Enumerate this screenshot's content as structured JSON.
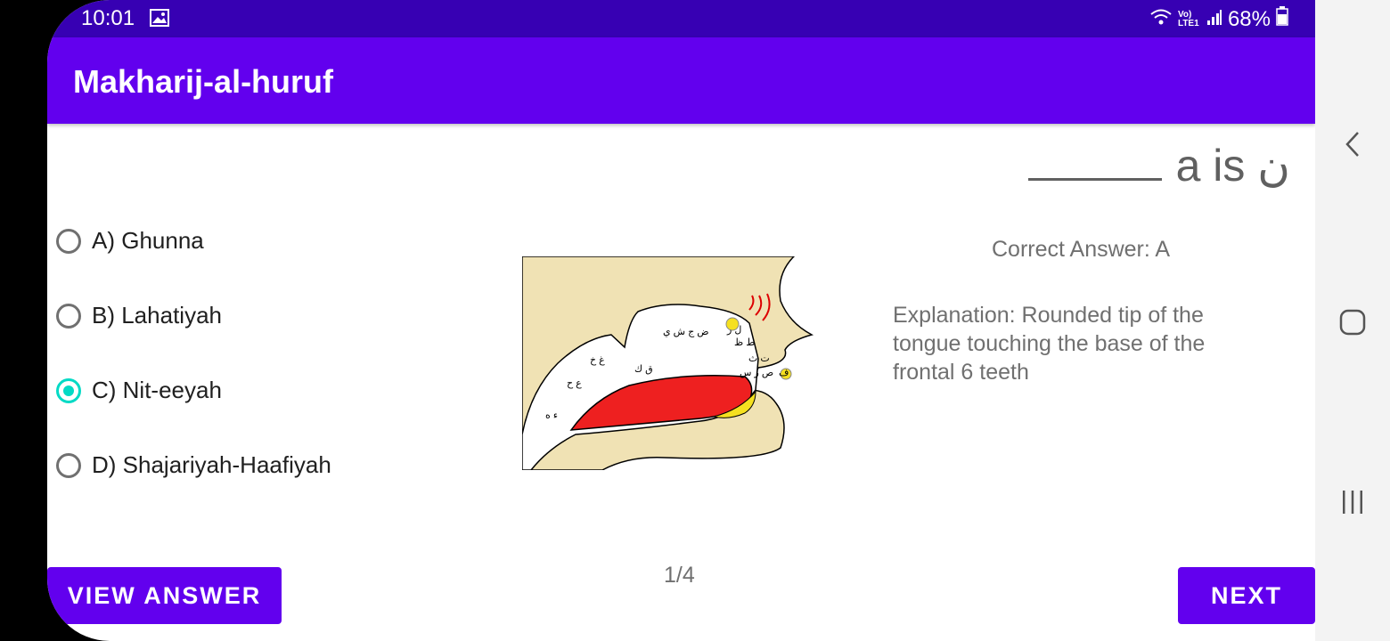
{
  "status": {
    "time": "10:01",
    "network": "Vo) LTE1",
    "battery": "68%"
  },
  "app": {
    "title": "Makharij-al-huruf"
  },
  "question": {
    "text": "a is ن"
  },
  "options": [
    {
      "label": "A) Ghunna",
      "selected": false
    },
    {
      "label": "B) Lahatiyah",
      "selected": false
    },
    {
      "label": "C) Nit-eeyah",
      "selected": true
    },
    {
      "label": "D) Shajariyah-Haafiyah",
      "selected": false
    }
  ],
  "answer": {
    "correct": "Correct Answer: A",
    "explanation": "Explanation: Rounded tip of the tongue touching the base of the frontal 6 teeth"
  },
  "diagram": {
    "labels": [
      "ض ج ش ي",
      "غ خ",
      "ع ح",
      "ق ك",
      "ء ه",
      "ل ر",
      "ط ظ",
      "ت ث",
      "ص ز س",
      "ف"
    ]
  },
  "buttons": {
    "view_answer": "VIEW ANSWER",
    "next": "NEXT"
  },
  "pagination": {
    "counter": "1/4"
  },
  "colors": {
    "primary": "#6200ee",
    "status_bar": "#3700b3",
    "accent": "#03dac5",
    "tongue": "#ee2020"
  },
  "icons": [
    "gallery-icon",
    "wifi-icon",
    "signal-icon",
    "battery-icon",
    "back-nav-icon",
    "home-nav-icon",
    "recents-nav-icon"
  ]
}
